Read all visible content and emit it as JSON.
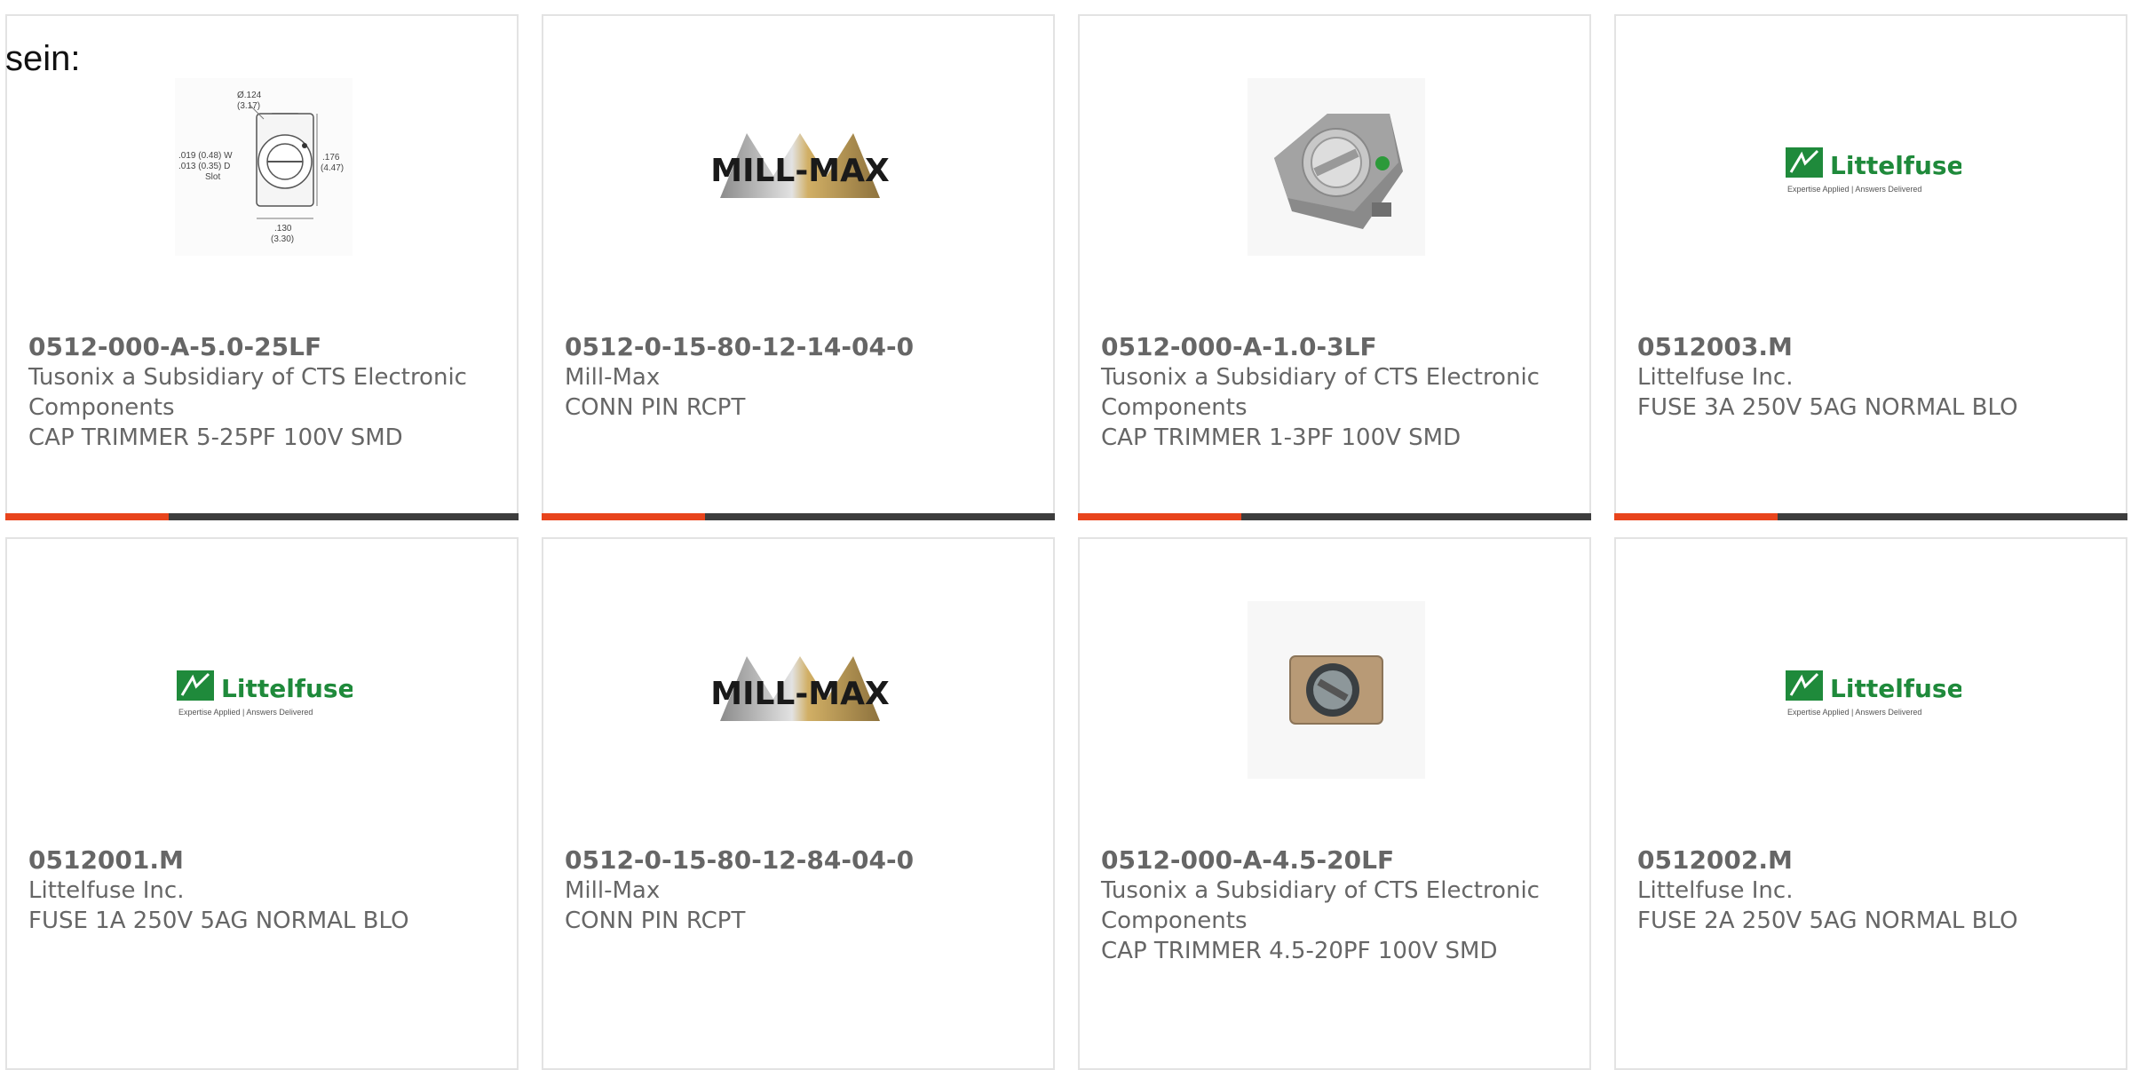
{
  "intro_text": "sein:",
  "colors": {
    "accent": "#e8441c",
    "bar_dark": "#3d3d3d",
    "littelfuse_green": "#1f8a3b"
  },
  "cards": [
    {
      "part_number": "0512-000-A-5.0-25LF",
      "manufacturer": "Tusonix a Subsidiary of CTS Electronic Components",
      "description": "CAP TRIMMER 5-25PF 100V SMD",
      "image": "dimension-drawing",
      "drawing": {
        "dia": "Ø.124",
        "dia_mm": "(3.17)",
        "w": ".019 (0.48) W",
        "d": ".013 (0.35) D",
        "slot": "Slot",
        "h": ".176",
        "h_mm": "(4.47)",
        "b": ".130",
        "b_mm": "(3.30)"
      }
    },
    {
      "part_number": "0512-0-15-80-12-14-04-0",
      "manufacturer": "Mill-Max",
      "description": "CONN PIN RCPT",
      "image": "mill-max-logo",
      "logo_text": "MILL-MAX"
    },
    {
      "part_number": "0512-000-A-1.0-3LF",
      "manufacturer": "Tusonix a Subsidiary of CTS Electronic Components",
      "description": "CAP TRIMMER 1-3PF 100V SMD",
      "image": "trimmer-photo"
    },
    {
      "part_number": "0512003.M",
      "manufacturer": "Littelfuse Inc.",
      "description": "FUSE 3A 250V 5AG NORMAL BLO",
      "image": "littelfuse-logo",
      "logo_text": "Littelfuse",
      "tagline": "Expertise Applied | Answers Delivered"
    },
    {
      "part_number": "0512001.M",
      "manufacturer": "Littelfuse Inc.",
      "description": "FUSE 1A 250V 5AG NORMAL BLO",
      "image": "littelfuse-logo",
      "logo_text": "Littelfuse",
      "tagline": "Expertise Applied | Answers Delivered"
    },
    {
      "part_number": "0512-0-15-80-12-84-04-0",
      "manufacturer": "Mill-Max",
      "description": "CONN PIN RCPT",
      "image": "mill-max-logo",
      "logo_text": "MILL-MAX"
    },
    {
      "part_number": "0512-000-A-4.5-20LF",
      "manufacturer": "Tusonix a Subsidiary of CTS Electronic Components",
      "description": "CAP TRIMMER 4.5-20PF 100V SMD",
      "image": "trimmer-photo-small"
    },
    {
      "part_number": "0512002.M",
      "manufacturer": "Littelfuse Inc.",
      "description": "FUSE 2A 250V 5AG NORMAL BLO",
      "image": "littelfuse-logo",
      "logo_text": "Littelfuse",
      "tagline": "Expertise Applied | Answers Delivered"
    }
  ]
}
